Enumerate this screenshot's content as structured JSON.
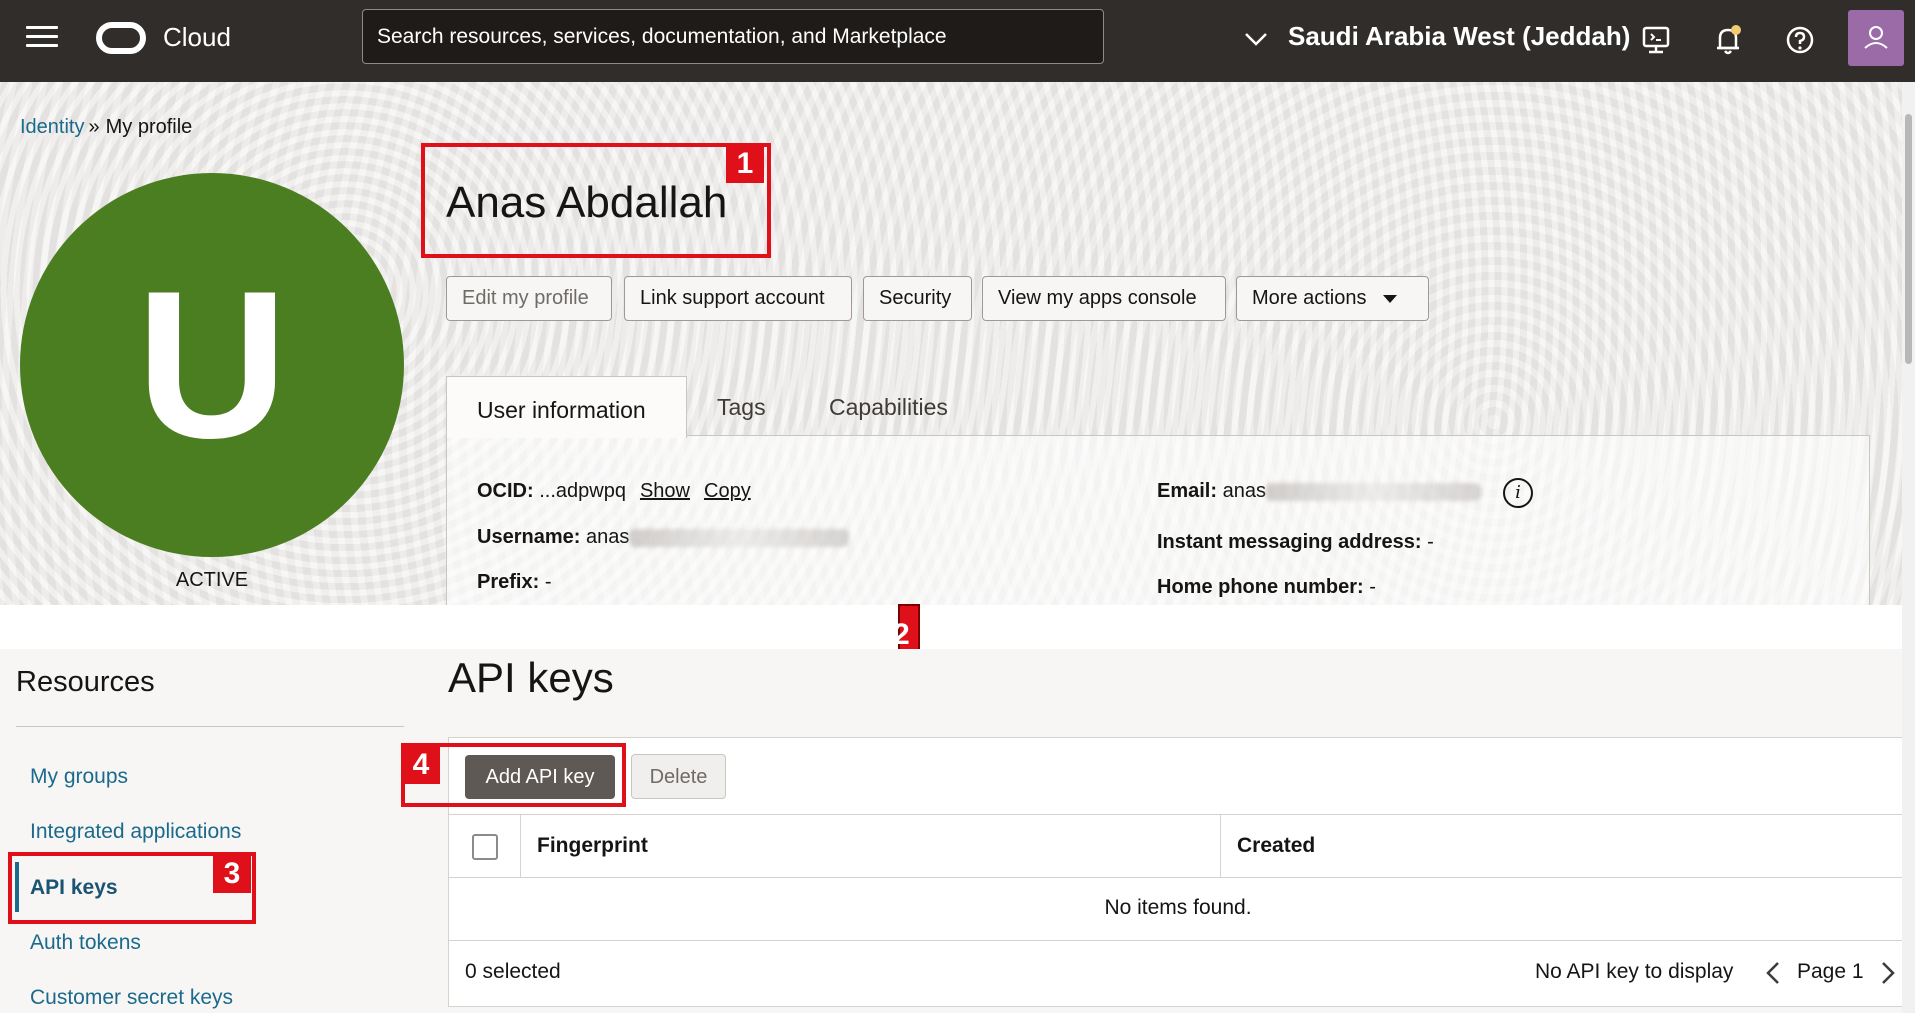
{
  "topbar": {
    "brand": "Cloud",
    "search_placeholder": "Search resources, services, documentation, and Marketplace",
    "region": "Saudi Arabia West (Jeddah)",
    "icons": [
      "menu-icon",
      "oracle-logo-icon",
      "chevron-down-icon",
      "developer-tools-icon",
      "bell-icon",
      "help-icon",
      "user-icon"
    ]
  },
  "breadcrumb": {
    "parent": "Identity",
    "separator": "»",
    "current": "My profile"
  },
  "profile": {
    "avatar_letter": "U",
    "avatar_color": "#4b7d21",
    "status": "ACTIVE",
    "name": "Anas Abdallah"
  },
  "actions": {
    "edit": "Edit my profile",
    "link_support": "Link support account",
    "security": "Security",
    "view_apps": "View my apps console",
    "more": "More actions"
  },
  "tabs": {
    "user_info": "User information",
    "tags": "Tags",
    "capabilities": "Capabilities"
  },
  "user_info": {
    "ocid_label": "OCID:",
    "ocid_value": "...adpwpq",
    "show": "Show",
    "copy": "Copy",
    "username_label": "Username:",
    "username_value": "anas",
    "prefix_label": "Prefix:",
    "prefix_value": "-",
    "email_label": "Email:",
    "email_value": "anas",
    "im_label": "Instant messaging address:",
    "im_value": "-",
    "phone_label": "Home phone number:",
    "phone_value": "-"
  },
  "annotations": {
    "n1": "1",
    "n2": "2",
    "n3": "3",
    "n4": "4",
    "color": "#e0101a"
  },
  "resources": {
    "title": "Resources",
    "items": [
      "My groups",
      "Integrated applications",
      "API keys",
      "Auth tokens",
      "Customer secret keys"
    ]
  },
  "api_keys": {
    "title": "API keys",
    "add_button": "Add API key",
    "delete_button": "Delete",
    "columns": [
      "Fingerprint",
      "Created"
    ],
    "empty_message": "No items found.",
    "selected": "0 selected",
    "no_items": "No API key to display",
    "page": "Page 1"
  }
}
